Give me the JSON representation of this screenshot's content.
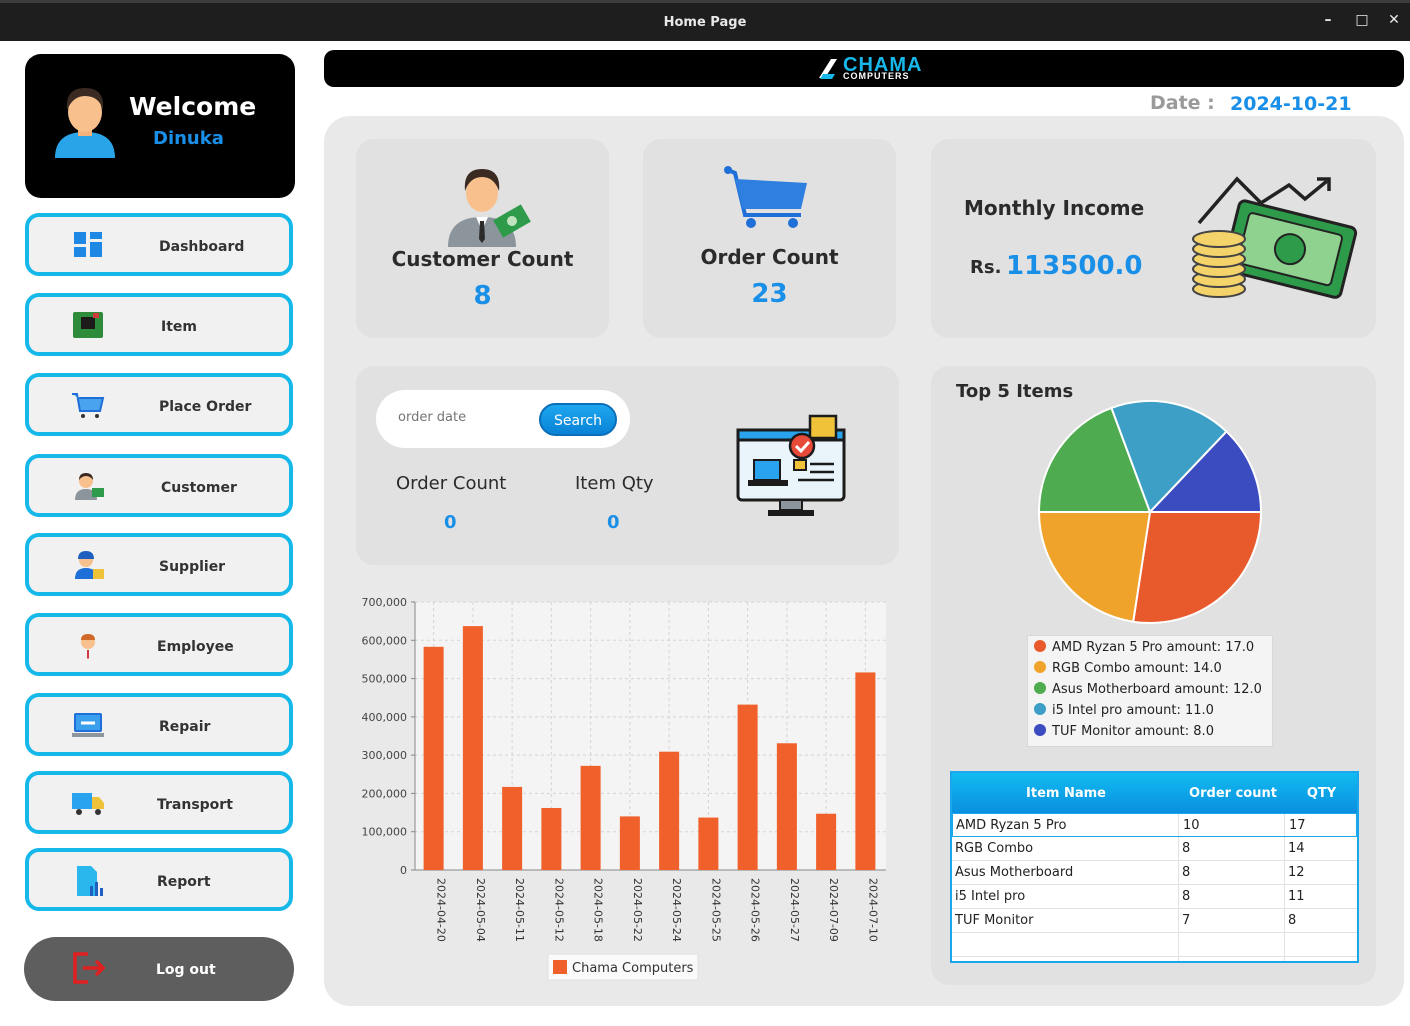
{
  "window": {
    "title": "Home Page",
    "minimize": "–",
    "maximize": "□",
    "close": "✕"
  },
  "user": {
    "greeting": "Welcome",
    "name": "Dinuka"
  },
  "nav": [
    {
      "label": "Dashboard",
      "icon": "dashboard-icon"
    },
    {
      "label": "Item",
      "icon": "circuit-board-icon"
    },
    {
      "label": "Place Order",
      "icon": "cart-icon"
    },
    {
      "label": "Customer",
      "icon": "customer-icon"
    },
    {
      "label": "Supplier",
      "icon": "supplier-icon"
    },
    {
      "label": "Employee",
      "icon": "employee-icon"
    },
    {
      "label": "Repair",
      "icon": "repair-icon"
    },
    {
      "label": "Transport",
      "icon": "truck-icon"
    },
    {
      "label": "Report",
      "icon": "report-icon"
    }
  ],
  "logout_label": "Log out",
  "brand": {
    "line1": "CHAMA",
    "line2": "COMPUTERS"
  },
  "date": {
    "label": "Date :",
    "value": "2024-10-21"
  },
  "stats": {
    "customer": {
      "title": "Customer Count",
      "value": "8"
    },
    "order": {
      "title": "Order Count",
      "value": "23"
    },
    "income": {
      "title": "Monthly Income",
      "prefix": "Rs.",
      "value": "113500.0"
    }
  },
  "search": {
    "placeholder": "order date",
    "button": "Search",
    "order_count_label": "Order Count",
    "order_count_value": "0",
    "item_qty_label": "Item Qty",
    "item_qty_value": "0"
  },
  "chart_data": [
    {
      "type": "bar",
      "categories": [
        "2024-04-20",
        "2024-05-04",
        "2024-05-11",
        "2024-05-12",
        "2024-05-18",
        "2024-05-22",
        "2024-05-24",
        "2024-05-25",
        "2024-05-26",
        "2024-05-27",
        "2024-07-09",
        "2024-07-10"
      ],
      "series": [
        {
          "name": "Chama Computers",
          "values": [
            583000,
            637000,
            217000,
            162000,
            272000,
            140000,
            309000,
            137000,
            432000,
            331000,
            147000,
            516000
          ],
          "color": "#f0602a"
        }
      ],
      "ylim": [
        0,
        700000
      ],
      "yticks": [
        "0",
        "100,000",
        "200,000",
        "300,000",
        "400,000",
        "500,000",
        "600,000",
        "700,000"
      ],
      "grid": true,
      "legend": "bottom"
    },
    {
      "type": "pie",
      "title": "Top 5 Items",
      "slices": [
        {
          "label": "AMD Ryzan 5 Pro",
          "value": 17.0,
          "legend": "AMD Ryzan 5 Pro  amount: 17.0",
          "color": "#e85a2c"
        },
        {
          "label": "RGB Combo",
          "value": 14.0,
          "legend": "RGB Combo   amount: 14.0",
          "color": "#f0a32a"
        },
        {
          "label": "Asus Motherboard",
          "value": 12.0,
          "legend": "Asus Motherboard  amount: 12.0",
          "color": "#4fab4f"
        },
        {
          "label": "i5 Intel pro",
          "value": 11.0,
          "legend": "i5 Intel pro  amount: 11.0",
          "color": "#3d9fc6"
        },
        {
          "label": "TUF Monitor",
          "value": 8.0,
          "legend": "TUF Monitor  amount: 8.0",
          "color": "#3b4cc0"
        }
      ],
      "legend": "bottom"
    }
  ],
  "table": {
    "headers": [
      "Item Name",
      "Order count",
      "QTY"
    ],
    "rows": [
      [
        "AMD Ryzan 5 Pro",
        "10",
        "17"
      ],
      [
        "RGB Combo",
        "8",
        "14"
      ],
      [
        "Asus Motherboard",
        "8",
        "12"
      ],
      [
        "i5 Intel pro",
        "8",
        "11"
      ],
      [
        "TUF Monitor",
        "7",
        "8"
      ]
    ]
  }
}
